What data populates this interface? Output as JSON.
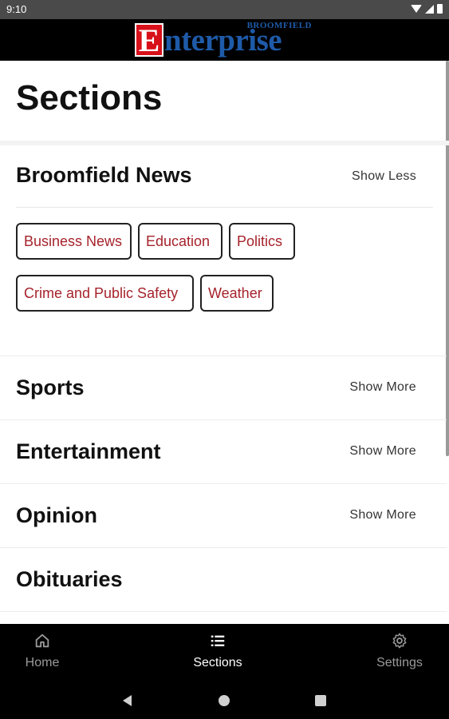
{
  "status_bar": {
    "time": "9:10"
  },
  "masthead": {
    "logo_top": "BROOMFIELD",
    "logo_initial": "E",
    "logo_word": "nterprise"
  },
  "page": {
    "title": "Sections"
  },
  "sections": [
    {
      "name": "Broomfield News",
      "toggle": "Show Less",
      "expanded": true,
      "subsections": [
        "Business News",
        "Education",
        "Politics",
        "Crime and Public Safety",
        "Weather"
      ]
    },
    {
      "name": "Sports",
      "toggle": "Show More"
    },
    {
      "name": "Entertainment",
      "toggle": "Show More"
    },
    {
      "name": "Opinion",
      "toggle": "Show More"
    },
    {
      "name": "Obituaries",
      "toggle": ""
    }
  ],
  "bottom_nav": [
    {
      "label": "Home",
      "icon": "home-icon",
      "active": false
    },
    {
      "label": "Sections",
      "icon": "list-icon",
      "active": true
    },
    {
      "label": "Settings",
      "icon": "gear-icon",
      "active": false
    }
  ],
  "colors": {
    "chip_text": "#a6232c",
    "logo_red": "#d8101a",
    "logo_blue": "#1e5aa8"
  }
}
